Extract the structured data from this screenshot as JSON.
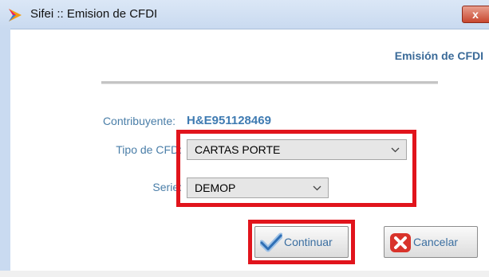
{
  "window": {
    "title": "Sifei :: Emision de CFDI",
    "close_label": "x"
  },
  "header": {
    "title": "Emisión de CFDI"
  },
  "form": {
    "contribuyente_label": "Contribuyente:",
    "contribuyente_value": "H&E951128469",
    "tipo_label": "Tipo de CFD:",
    "tipo_value": "CARTAS PORTE",
    "serie_label": "Serie:",
    "serie_value": "DEMOP"
  },
  "buttons": {
    "continuar": "Continuar",
    "cancelar": "Cancelar"
  },
  "icons": {
    "app": "sifei-logo-icon",
    "select_arrow": "chevron-down-icon",
    "continuar": "checkmark-icon",
    "cancelar": "red-x-icon"
  },
  "colors": {
    "highlight": "#e1141c",
    "label": "#4a7ea8",
    "value": "#3f7bb2",
    "header": "#3a6a98"
  }
}
